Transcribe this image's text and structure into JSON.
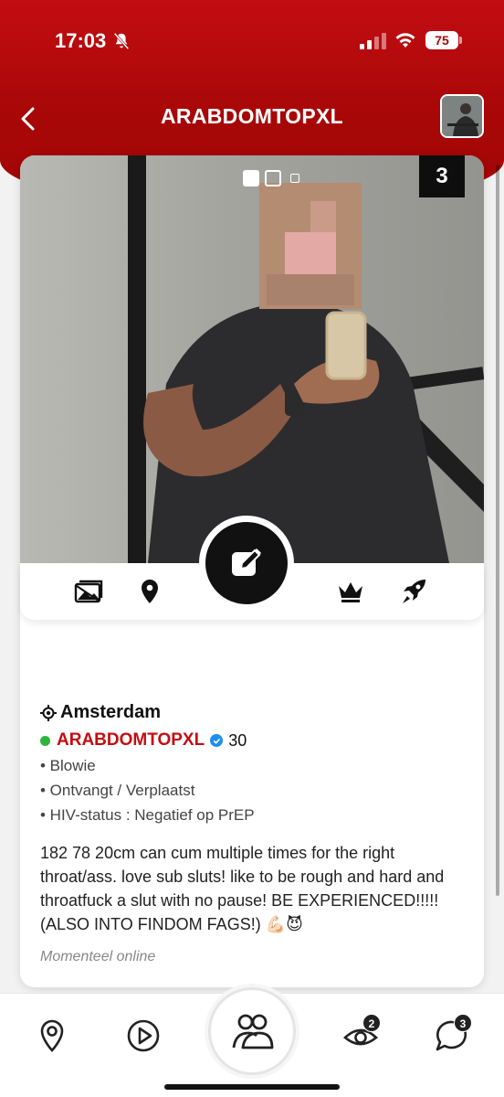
{
  "status_bar": {
    "time": "17:03",
    "battery": "75"
  },
  "header": {
    "title": "ARABDOMTOPXL"
  },
  "photo": {
    "count": "3",
    "pages": [
      "photo",
      "photo",
      "video"
    ],
    "current_page": 1
  },
  "profile": {
    "location": "Amsterdam",
    "username": "ARABDOMTOPXL",
    "age": "30",
    "attributes": [
      "• Blowie",
      "• Ontvangt / Verplaatst",
      "• HIV-status : Negatief op PrEP"
    ],
    "bio": "182 78 20cm can cum multiple times for the right throat/ass. love sub sluts! like to be rough and hard and throatfuck a slut with no pause! BE EXPERIENCED!!!!! (ALSO INTO FINDOM FAGS!) 💪🏻😈",
    "online_status": "Momenteel online"
  },
  "actions": [
    "photos-icon",
    "location-pin-icon",
    "edit-icon",
    "crown-icon",
    "rocket-icon"
  ],
  "bottom_nav": {
    "items": [
      "map-pin-icon",
      "play-icon",
      "people-icon",
      "eye-icon",
      "chat-icon"
    ],
    "eye_badge": "2",
    "chat_badge": "3"
  },
  "colors": {
    "brand_red": "#c30d12",
    "online_green": "#2db43a",
    "verified_blue": "#1f8ef1"
  }
}
